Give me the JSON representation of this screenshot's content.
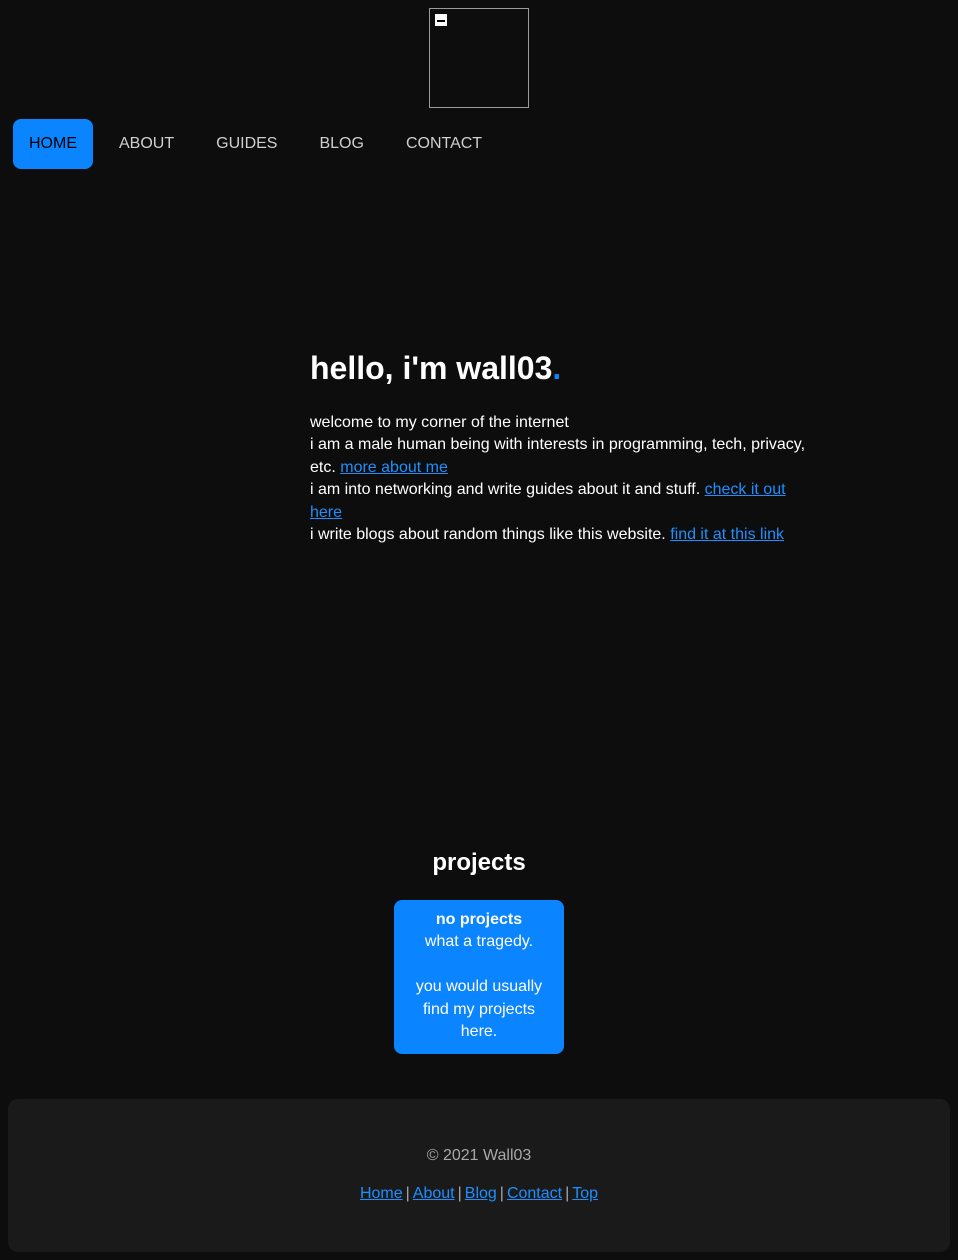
{
  "nav": {
    "items": [
      {
        "label": "HOME",
        "active": true
      },
      {
        "label": "ABOUT",
        "active": false
      },
      {
        "label": "GUIDES",
        "active": false
      },
      {
        "label": "BLOG",
        "active": false
      },
      {
        "label": "CONTACT",
        "active": false
      }
    ]
  },
  "hero": {
    "title": "hello, i'm wall03",
    "title_dot": ".",
    "line1": "welcome to my corner of the internet",
    "line2": "i am a male human being with interests in programming, tech, privacy, etc.",
    "line2_link": "more about me",
    "line3": "i am into networking and write guides about it and stuff.",
    "line3_link": "check it out here",
    "line4": "i write blogs about random things like this website.",
    "line4_link": "find it at this link"
  },
  "projects": {
    "title": "projects",
    "card": {
      "title": "no projects",
      "line1": "what a tragedy.",
      "line2": "you would usually find my projects here."
    }
  },
  "footer": {
    "copyright": "© 2021 Wall03",
    "links": [
      "Home",
      "About",
      "Blog",
      "Contact",
      "Top"
    ],
    "separator": "|"
  },
  "colors": {
    "background": "#0d0d0d",
    "accent": "#0a84ff",
    "link": "#1f8fff",
    "footer_bg": "#1a1a1a"
  },
  "icons": {
    "logo": "broken-image-icon"
  }
}
